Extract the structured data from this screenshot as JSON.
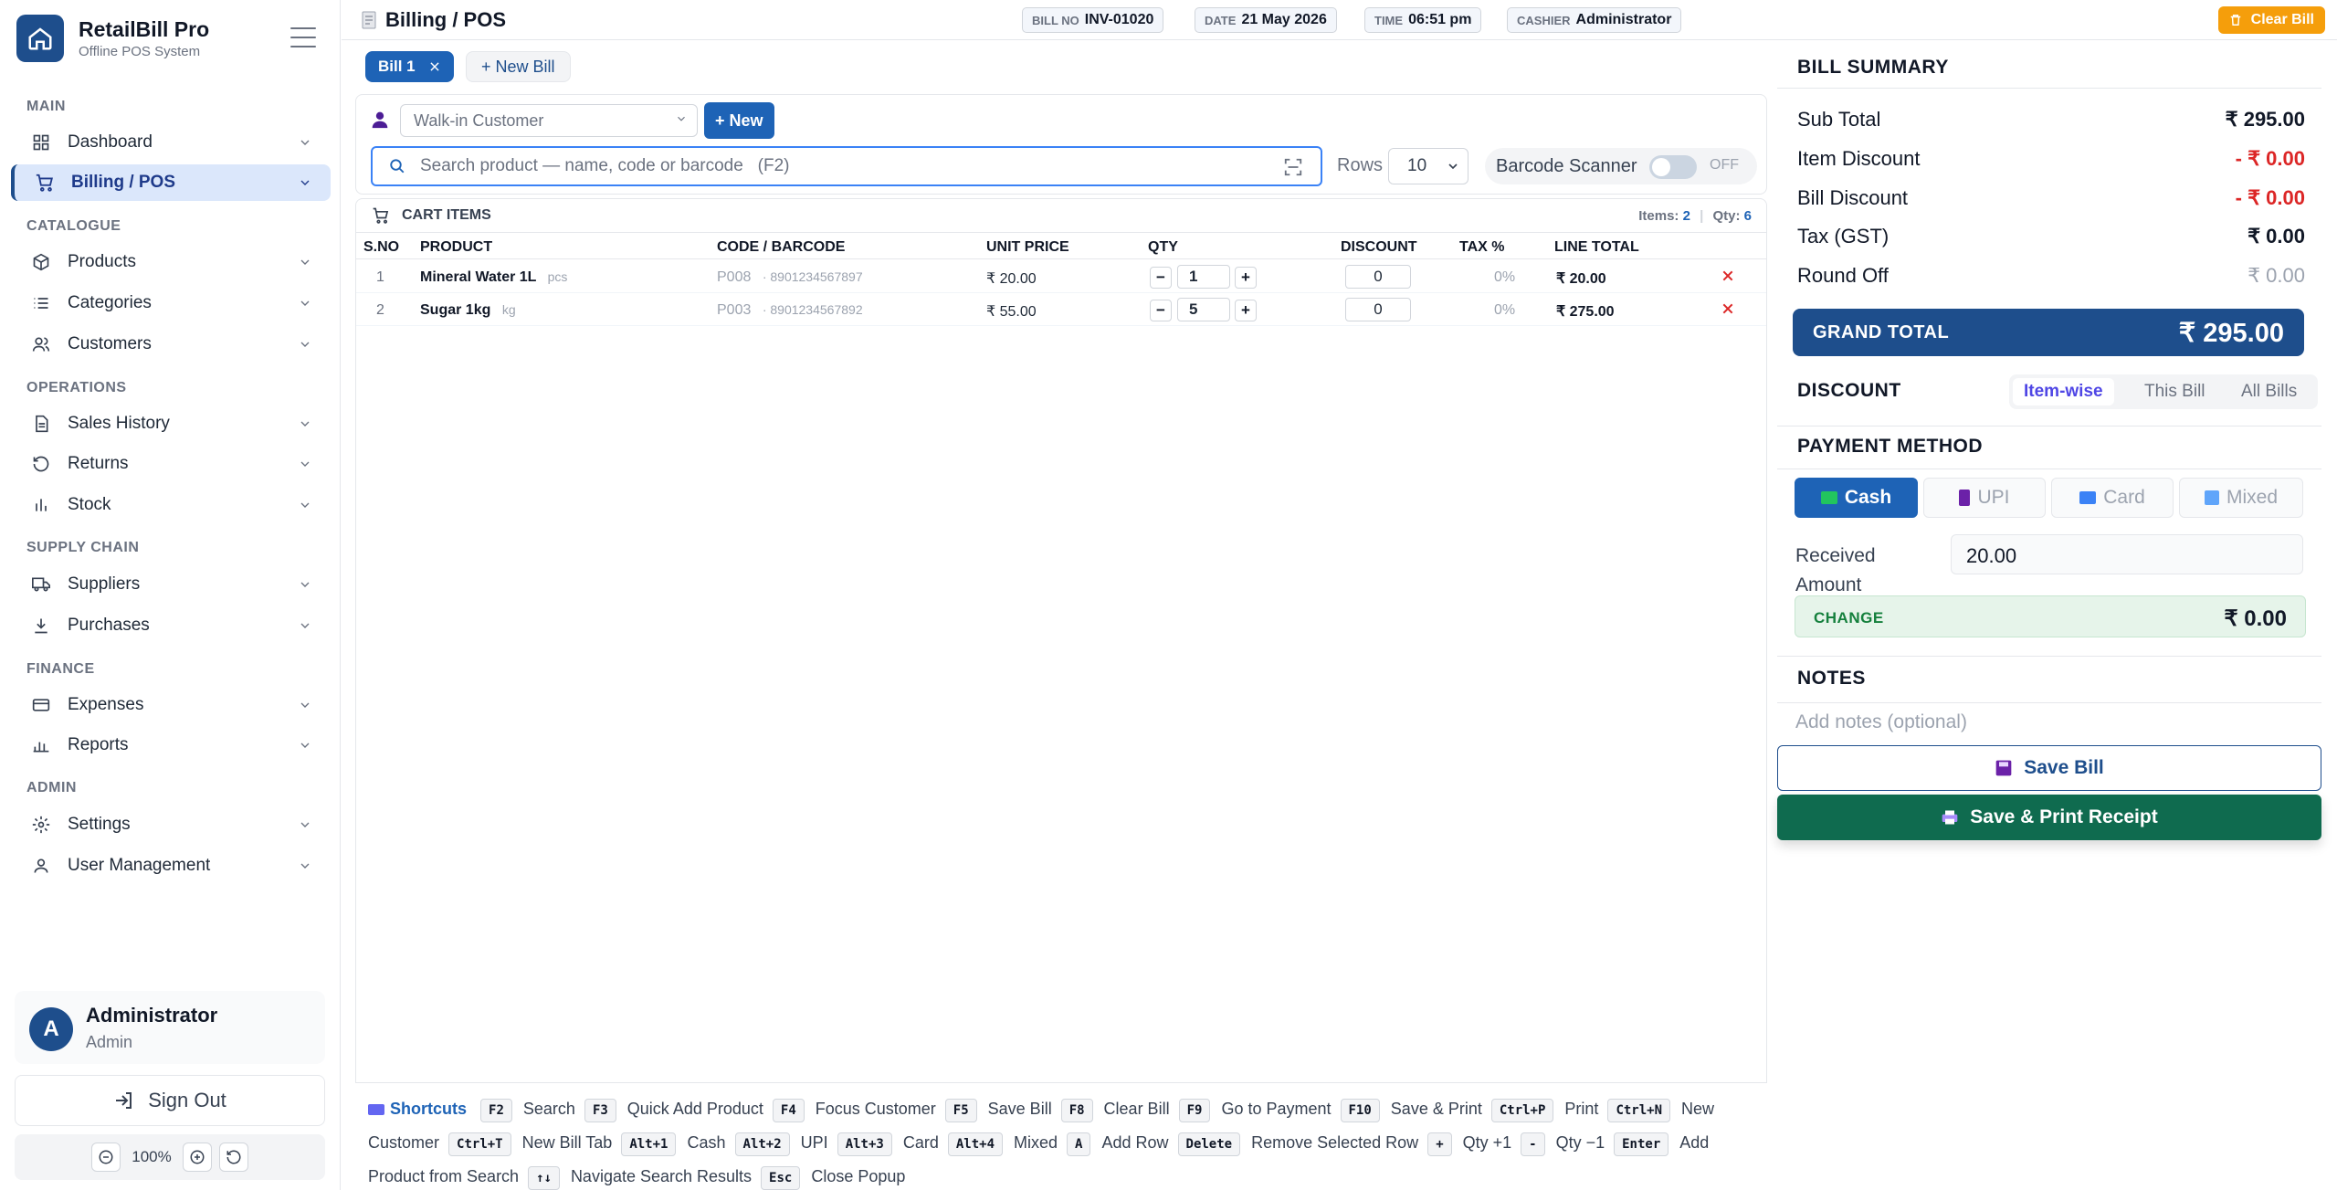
{
  "brand": {
    "name": "RetailBill Pro",
    "subtitle": "Offline POS System"
  },
  "sidebar": {
    "sections": [
      {
        "title": "MAIN",
        "items": [
          {
            "label": "Dashboard",
            "icon": "grid-icon"
          },
          {
            "label": "Billing / POS",
            "icon": "cart-icon",
            "active": true
          }
        ]
      },
      {
        "title": "CATALOGUE",
        "items": [
          {
            "label": "Products",
            "icon": "box-icon"
          },
          {
            "label": "Categories",
            "icon": "list-icon"
          },
          {
            "label": "Customers",
            "icon": "users-icon"
          }
        ]
      },
      {
        "title": "OPERATIONS",
        "items": [
          {
            "label": "Sales History",
            "icon": "document-icon"
          },
          {
            "label": "Returns",
            "icon": "undo-icon"
          },
          {
            "label": "Stock",
            "icon": "bar-chart-icon"
          }
        ]
      },
      {
        "title": "SUPPLY CHAIN",
        "items": [
          {
            "label": "Suppliers",
            "icon": "truck-icon"
          },
          {
            "label": "Purchases",
            "icon": "download-icon"
          }
        ]
      },
      {
        "title": "FINANCE",
        "items": [
          {
            "label": "Expenses",
            "icon": "credit-card-icon"
          },
          {
            "label": "Reports",
            "icon": "chart-icon"
          }
        ]
      },
      {
        "title": "ADMIN",
        "items": [
          {
            "label": "Settings",
            "icon": "gear-icon"
          },
          {
            "label": "User Management",
            "icon": "user-icon"
          }
        ]
      }
    ],
    "user": {
      "initial": "A",
      "name": "Administrator",
      "role": "Admin"
    },
    "sign_out": "Sign Out",
    "zoom": "100%"
  },
  "header": {
    "title": "Billing / POS",
    "bill_no_label": "BILL NO",
    "bill_no": "INV-01020",
    "date_label": "DATE",
    "date": "21 May 2026",
    "time_label": "TIME",
    "time": "06:51 pm",
    "cashier_label": "CASHIER",
    "cashier": "Administrator",
    "clear_bill": "Clear Bill"
  },
  "tabs": {
    "bill": "Bill 1",
    "new_bill": "+ New Bill"
  },
  "customer": {
    "selected": "Walk-in Customer",
    "new_button": "+ New"
  },
  "search": {
    "placeholder": "Search product — name, code or barcode   (F2)",
    "rows_label": "Rows",
    "rows_value": "10",
    "scanner_label": "Barcode Scanner",
    "scanner_state": "OFF"
  },
  "cart": {
    "title": "CART ITEMS",
    "items_label": "Items:",
    "items_count": "2",
    "qty_label": "Qty:",
    "qty_count": "6",
    "columns": [
      "S.NO",
      "PRODUCT",
      "CODE / BARCODE",
      "UNIT PRICE",
      "QTY",
      "DISCOUNT",
      "TAX %",
      "LINE TOTAL"
    ],
    "rows": [
      {
        "sno": "1",
        "product": "Mineral Water 1L",
        "unit": "pcs",
        "code": "P008",
        "barcode": "· 8901234567897",
        "price": "₹ 20.00",
        "qty": "1",
        "discount": "0",
        "tax": "0%",
        "total": "₹ 20.00"
      },
      {
        "sno": "2",
        "product": "Sugar 1kg",
        "unit": "kg",
        "code": "P003",
        "barcode": "· 8901234567892",
        "price": "₹ 55.00",
        "qty": "5",
        "discount": "0",
        "tax": "0%",
        "total": "₹ 275.00"
      }
    ]
  },
  "shortcuts": {
    "title": "Shortcuts",
    "items": [
      {
        "key": "F2",
        "label": "Search"
      },
      {
        "key": "F3",
        "label": "Quick Add Product"
      },
      {
        "key": "F4",
        "label": "Focus Customer"
      },
      {
        "key": "F5",
        "label": "Save Bill"
      },
      {
        "key": "F8",
        "label": "Clear Bill"
      },
      {
        "key": "F9",
        "label": "Go to Payment"
      },
      {
        "key": "F10",
        "label": "Save & Print"
      },
      {
        "key": "Ctrl+P",
        "label": "Print"
      },
      {
        "key": "Ctrl+N",
        "label": "New Customer"
      },
      {
        "key": "Ctrl+T",
        "label": "New Bill Tab"
      },
      {
        "key": "Alt+1",
        "label": "Cash"
      },
      {
        "key": "Alt+2",
        "label": "UPI"
      },
      {
        "key": "Alt+3",
        "label": "Card"
      },
      {
        "key": "Alt+4",
        "label": "Mixed"
      },
      {
        "key": "A",
        "label": "Add Row"
      },
      {
        "key": "Delete",
        "label": "Remove Selected Row"
      },
      {
        "key": "+",
        "label": "Qty +1"
      },
      {
        "key": "-",
        "label": "Qty −1"
      },
      {
        "key": "Enter",
        "label": "Add Product from Search"
      },
      {
        "key": "↑↓",
        "label": "Navigate Search Results"
      },
      {
        "key": "Esc",
        "label": "Close Popup"
      }
    ]
  },
  "summary": {
    "title": "BILL SUMMARY",
    "rows": [
      {
        "label": "Sub Total",
        "value": "₹ 295.00"
      },
      {
        "label": "Item Discount",
        "value": "- ₹ 0.00"
      },
      {
        "label": "Bill Discount",
        "value": "- ₹ 0.00"
      },
      {
        "label": "Tax (GST)",
        "value": "₹ 0.00"
      },
      {
        "label": "Round Off",
        "value": "₹ 0.00"
      }
    ],
    "grand_label": "GRAND TOTAL",
    "grand_value": "₹ 295.00"
  },
  "discount": {
    "title": "DISCOUNT",
    "options": [
      "Item-wise",
      "This Bill",
      "All Bills"
    ]
  },
  "payment": {
    "title": "PAYMENT METHOD",
    "methods": [
      "Cash",
      "UPI",
      "Card",
      "Mixed"
    ],
    "received_label": "Received Amount",
    "received_value": "20.00",
    "change_label": "CHANGE",
    "change_value": "₹ 0.00"
  },
  "notes": {
    "title": "NOTES",
    "placeholder": "Add notes (optional)"
  },
  "actions": {
    "save": "Save Bill",
    "save_print": "Save & Print Receipt"
  },
  "colors": {
    "primary": "#1e4e8c",
    "accent": "#1e63b6",
    "warning": "#f59e0b",
    "danger": "#dc2626",
    "success": "#0f6b4f"
  }
}
